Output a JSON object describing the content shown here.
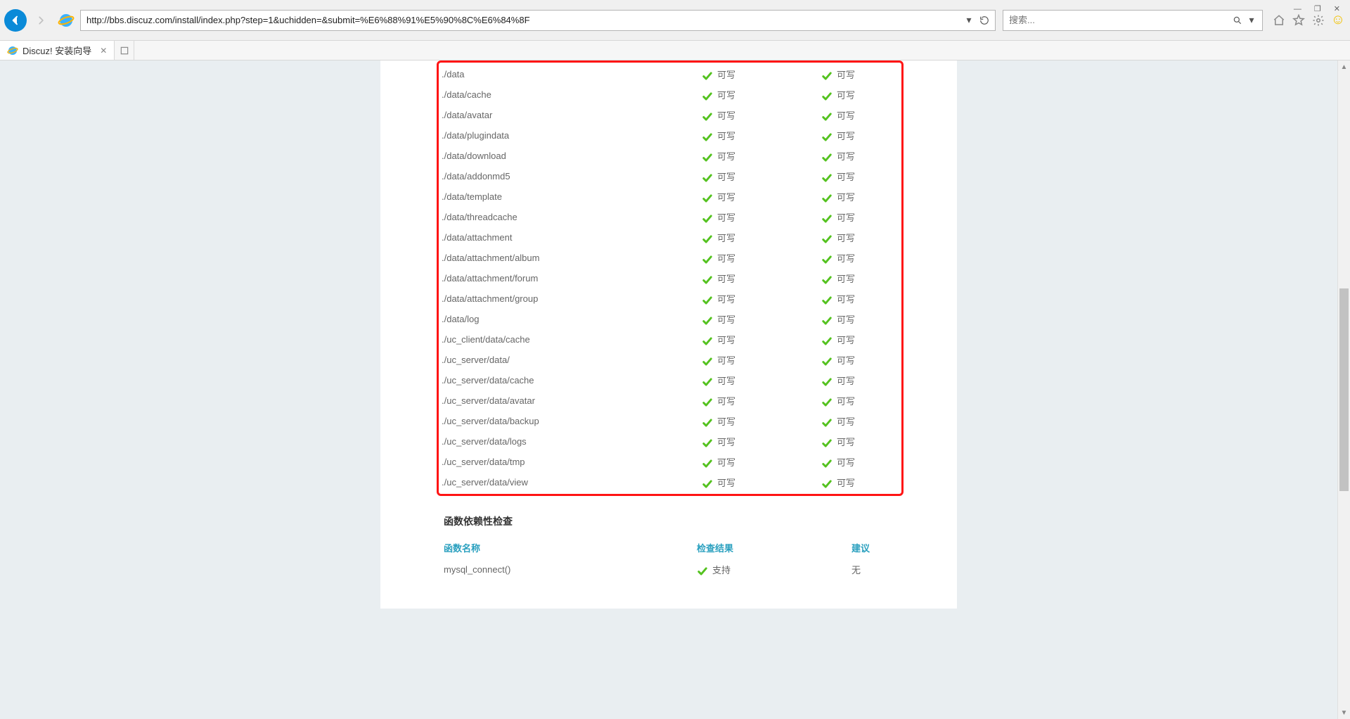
{
  "window_controls": {
    "min": "—",
    "max": "❐",
    "close": "✕"
  },
  "address_bar": {
    "url": "http://bbs.discuz.com/install/index.php?step=1&uchidden=&submit=%E6%88%91%E5%90%8C%E6%84%8F"
  },
  "search_bar": {
    "placeholder": "搜索..."
  },
  "tab": {
    "title": "Discuz! 安装向导"
  },
  "perm": {
    "writable_label": "可写",
    "rows": [
      {
        "path": "./data"
      },
      {
        "path": "./data/cache"
      },
      {
        "path": "./data/avatar"
      },
      {
        "path": "./data/plugindata"
      },
      {
        "path": "./data/download"
      },
      {
        "path": "./data/addonmd5"
      },
      {
        "path": "./data/template"
      },
      {
        "path": "./data/threadcache"
      },
      {
        "path": "./data/attachment"
      },
      {
        "path": "./data/attachment/album"
      },
      {
        "path": "./data/attachment/forum"
      },
      {
        "path": "./data/attachment/group"
      },
      {
        "path": "./data/log"
      },
      {
        "path": "./uc_client/data/cache"
      },
      {
        "path": "./uc_server/data/"
      },
      {
        "path": "./uc_server/data/cache"
      },
      {
        "path": "./uc_server/data/avatar"
      },
      {
        "path": "./uc_server/data/backup"
      },
      {
        "path": "./uc_server/data/logs"
      },
      {
        "path": "./uc_server/data/tmp"
      },
      {
        "path": "./uc_server/data/view"
      }
    ]
  },
  "fn_section": {
    "title": "函数依赖性检查",
    "headers": {
      "name": "函数名称",
      "result": "检查结果",
      "suggest": "建议"
    },
    "rows": [
      {
        "name": "mysql_connect()",
        "result": "支持",
        "suggest": "无"
      }
    ]
  }
}
